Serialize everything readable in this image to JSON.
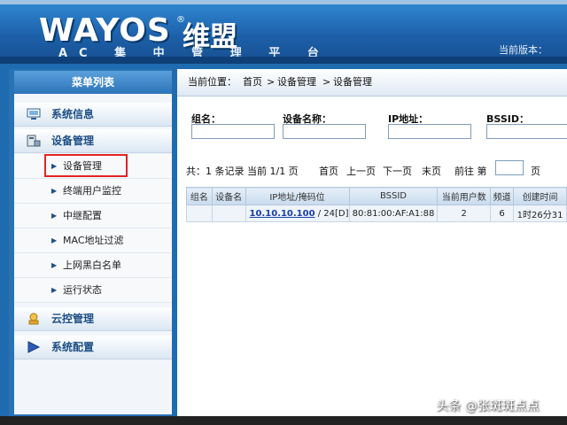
{
  "header": {
    "logo_text": "WAYOS",
    "logo_cn": "维盟",
    "subtitle": "AC 集 中 管 理 平 台",
    "version_label": "当前版本："
  },
  "sidebar": {
    "title": "菜单列表",
    "groups": [
      {
        "label": "系统信息",
        "icon": "system-info-icon"
      },
      {
        "label": "设备管理",
        "icon": "device-manage-icon"
      },
      {
        "label": "云控管理",
        "icon": "cloud-control-icon"
      },
      {
        "label": "系统配置",
        "icon": "system-config-icon"
      }
    ],
    "items": [
      {
        "label": "设备管理",
        "active": true
      },
      {
        "label": "终端用户监控"
      },
      {
        "label": "中继配置"
      },
      {
        "label": "MAC地址过滤"
      },
      {
        "label": "上网黑白名单"
      },
      {
        "label": "运行状态"
      }
    ]
  },
  "breadcrumb": {
    "prefix": "当前位置：",
    "home": "首页",
    "sep1": ">",
    "section": "设备管理",
    "sep2": ">",
    "page": "设备管理"
  },
  "filters": {
    "group_label": "组名：",
    "device_label": "设备名称：",
    "ip_label": "IP地址：",
    "bssid_label": "BSSID："
  },
  "pager": {
    "summary": "共：1 条记录 当前 1/1 页",
    "first": "首页",
    "prev": "上一页",
    "next": "下一页",
    "last": "末页",
    "goto": "前往 第",
    "page_unit": "页"
  },
  "table": {
    "headers": [
      "组名",
      "设备名",
      "IP地址/掩码位",
      "BSSID",
      "当前用户数",
      "频道",
      "创建时间"
    ],
    "rows": [
      {
        "group": "",
        "device": "",
        "ip": "10.10.10.100",
        "mask": " / 24[D]",
        "bssid": "80:81:00:AF:A1:88",
        "users": "2",
        "channel": "6",
        "created": "1时26分31"
      }
    ]
  },
  "watermark": "头条 @张斑斑点点",
  "colors": {
    "accent": "#1f6bb0",
    "active_border": "#e32424",
    "link": "#1a4fb8"
  }
}
